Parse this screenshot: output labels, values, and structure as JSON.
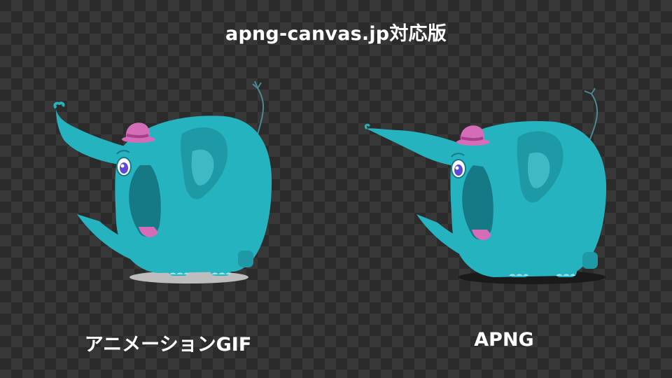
{
  "page": {
    "title": "apng-canvas.jp対応版"
  },
  "panels": [
    {
      "caption": "アニメーションGIF",
      "image": "elephant-gif-icon",
      "shadow_color": "#bdbdbd"
    },
    {
      "caption": "APNG",
      "image": "elephant-apng-icon",
      "shadow_color": "#1a1a1a"
    }
  ],
  "colors": {
    "elephant_body": "#26b3c0",
    "elephant_dark": "#157a86",
    "elephant_light": "#4cc8d3",
    "hat": "#d56cb8",
    "hat_band": "#a5408d",
    "eye_iris": "#5a4ad8",
    "feet": "#a8e6ea",
    "text": "#ffffff"
  }
}
